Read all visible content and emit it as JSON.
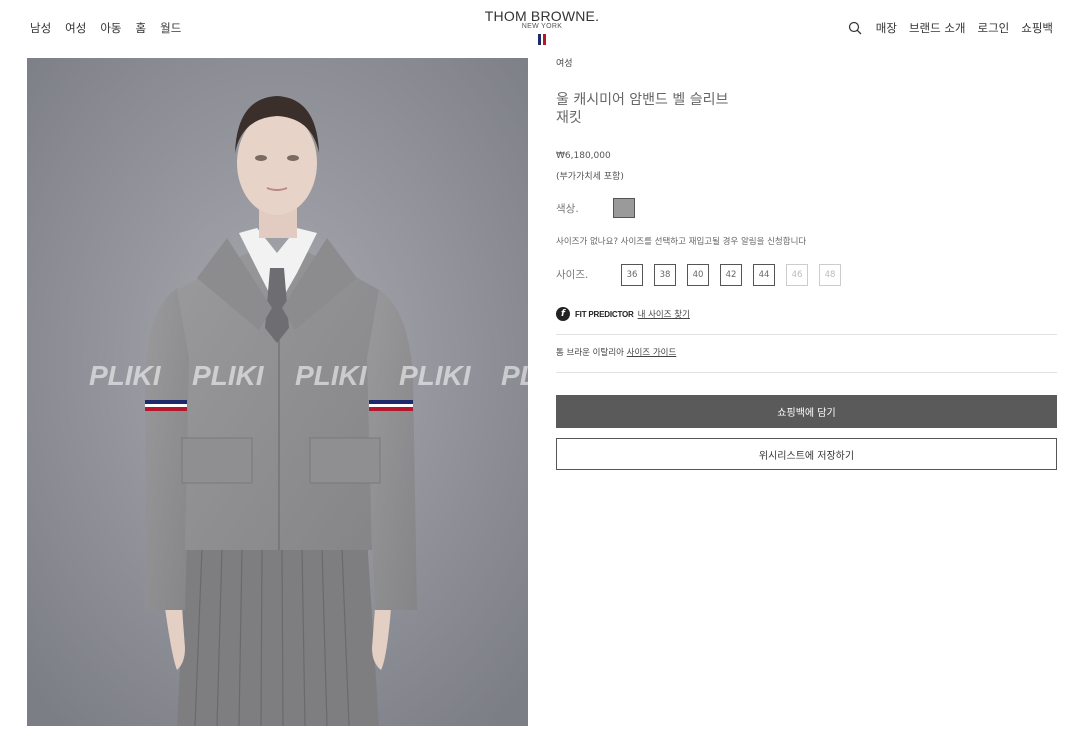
{
  "header": {
    "nav_left": [
      "남성",
      "여성",
      "아동",
      "홈",
      "월드"
    ],
    "logo": {
      "brand": "THOM BROWNE.",
      "sub": "NEW YORK"
    },
    "nav_right": [
      "매장",
      "브랜드 소개",
      "로그인",
      "쇼핑백"
    ],
    "search_icon": "search-icon",
    "flag_colors": [
      "#1f2a6b",
      "#ffffff",
      "#b3172b"
    ]
  },
  "product": {
    "image_watermark": "PLIKI",
    "category": "여성",
    "title_line1": "울 캐시미어 암밴드 벨 슬리브",
    "title_line2": "재킷",
    "price": "₩6,180,000",
    "tax_note": "(부가가치세 포함)",
    "color_label": "색상.",
    "color_swatch": "#9a9a9a",
    "size_notice": "사이즈가 없나요? 사이즈를 선택하고 재입고될 경우 알림을 신청합니다",
    "size_label": "사이즈.",
    "sizes": [
      {
        "label": "36",
        "available": true
      },
      {
        "label": "38",
        "available": true
      },
      {
        "label": "40",
        "available": true
      },
      {
        "label": "42",
        "available": true
      },
      {
        "label": "44",
        "available": true
      },
      {
        "label": "46",
        "available": false
      },
      {
        "label": "48",
        "available": false
      }
    ],
    "fit_predictor": {
      "icon": "f",
      "brand": "FIT PREDICTOR",
      "link": "내 사이즈 찾기"
    },
    "size_guide": {
      "prefix": "톰 브라운 이탈리아",
      "link": "사이즈 가이드"
    },
    "add_to_bag": "쇼핑백에 담기",
    "wishlist": "위시리스트에 저장하기"
  }
}
